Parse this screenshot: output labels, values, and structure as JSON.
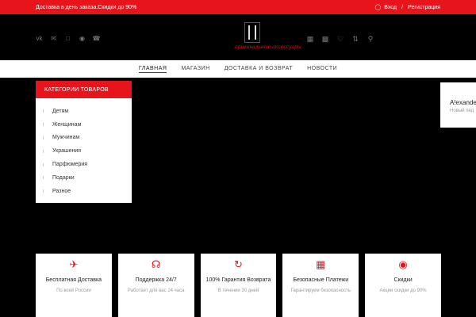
{
  "topbar": {
    "promo": "Доставка в день заказа.Скидки до 90%",
    "login": "Вход",
    "separator": "/",
    "register": "Регистрация"
  },
  "header": {
    "socials": [
      "vk-icon",
      "mail-icon",
      "instagram-icon",
      "messenger-icon",
      "whatsapp-icon"
    ],
    "logo_text": "оригинальные аксессуары",
    "tools": [
      "grid-icon",
      "cart-icon",
      "heart-icon",
      "compare-icon",
      "search-icon"
    ]
  },
  "nav": {
    "items": [
      {
        "label": "ГЛАВНАЯ"
      },
      {
        "label": "МАГАЗИН"
      },
      {
        "label": "ДОСТАВКА И ВОЗВРАТ"
      },
      {
        "label": "НОВОСТИ"
      }
    ]
  },
  "categories": {
    "title": "КАТЕГОРИИ ТОВАРОВ",
    "items": [
      "Детям",
      "Женщинам",
      "Мужчинам",
      "Украшения",
      "Парфюмерия",
      "Подарки",
      "Разное"
    ]
  },
  "popup": {
    "name": "A!exande",
    "sub": "Новый пед"
  },
  "features": [
    {
      "icon": "plane-icon",
      "title": "Бесплатная Доставка",
      "sub": "По всей России"
    },
    {
      "icon": "headset-icon",
      "title": "Поддержка 24/7",
      "sub": "Работает для вас 24 часа"
    },
    {
      "icon": "refresh-icon",
      "title": "100% Гарантия Возврата",
      "sub": "В течении 30 дней"
    },
    {
      "icon": "gift-icon",
      "title": "Безопасные Платежи",
      "sub": "Гарантируем безопасность"
    },
    {
      "icon": "piggybank-icon",
      "title": "Скидки",
      "sub": "Акции скидки до 90%"
    }
  ],
  "colors": {
    "accent": "#e8141b",
    "background": "#000000"
  }
}
